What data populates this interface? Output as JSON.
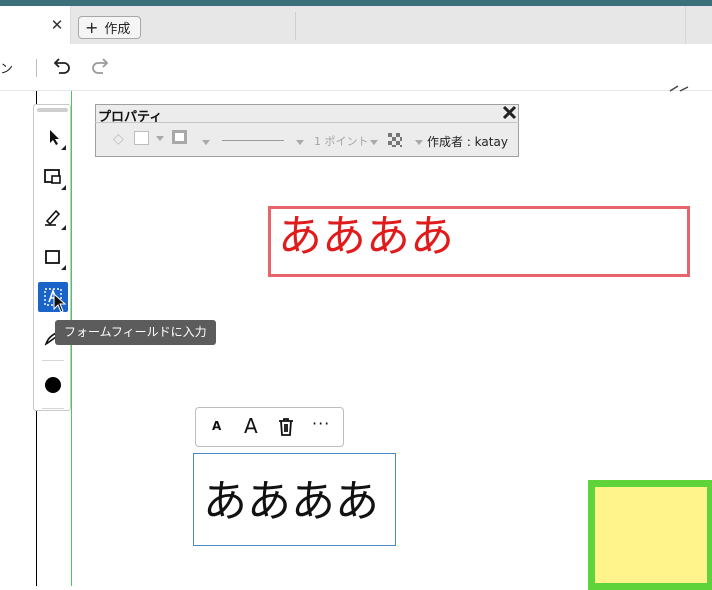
{
  "tabs": {
    "new_tab_label": "作成"
  },
  "toolbar": {
    "partial_label": "ン"
  },
  "palette": {
    "tooltip": "フォームフィールドに入力"
  },
  "properties": {
    "title": "プロパティ",
    "line_width": "1 ポイント",
    "author": "作成者 : katay"
  },
  "annotations": {
    "red_text": "ああああ",
    "text_box": "ああああ"
  },
  "mini_toolbar": {
    "small_font": "A",
    "large_font": "A",
    "more": "···"
  },
  "colors": {
    "tab_accent": "#3b6f7a",
    "tool_active": "#1a64c8",
    "red_border": "#e8646a",
    "red_text": "#e01b1b",
    "text_box_border": "#4a88c7",
    "highlight_fill": "#fff48c",
    "highlight_border": "#5fd43a",
    "page_edge": "#49c95b"
  }
}
